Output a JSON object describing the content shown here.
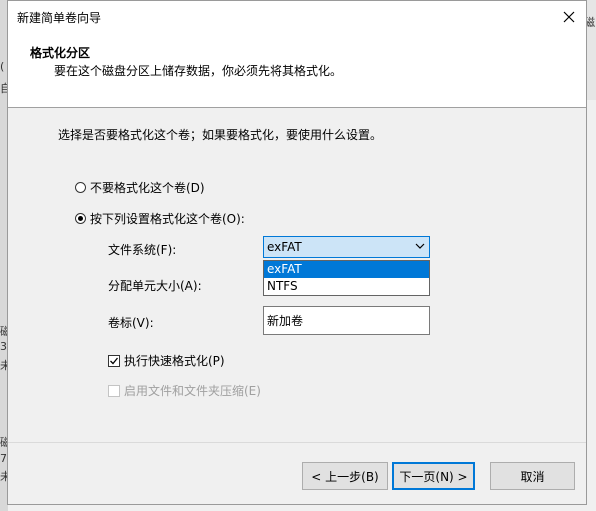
{
  "window": {
    "title": "新建简单卷向导"
  },
  "header": {
    "title": "格式化分区",
    "subtitle": "要在这个磁盘分区上储存数据，你必须先将其格式化。"
  },
  "intro": "选择是否要格式化这个卷；如果要格式化，要使用什么设置。",
  "options": {
    "no_format": "不要格式化这个卷(D)",
    "format": "按下列设置格式化这个卷(O):"
  },
  "fields": {
    "filesystem_label": "文件系统(F):",
    "filesystem_value": "exFAT",
    "filesystem_options": [
      "exFAT",
      "NTFS"
    ],
    "alloc_label": "分配单元大小(A):",
    "volume_label": "卷标(V):",
    "volume_value": "新加卷"
  },
  "checkboxes": {
    "quick_format": "执行快速格式化(P)",
    "compression": "启用文件和文件夹压缩(E)"
  },
  "buttons": {
    "back": "< 上一步(B)",
    "next": "下一页(N) >",
    "cancel": "取消"
  },
  "background_fragments": [
    "磁",
    "(",
    "自",
    "磁",
    "3",
    "未",
    "磁",
    "7",
    "未"
  ]
}
